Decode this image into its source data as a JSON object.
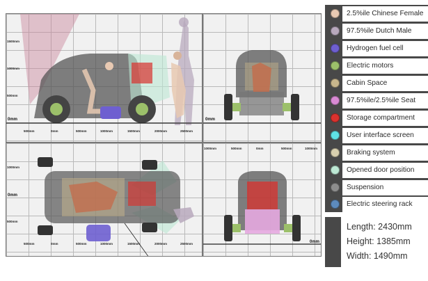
{
  "legend": {
    "items": [
      {
        "label": "2.5%ile Chinese Female",
        "color": "#e8c9b2"
      },
      {
        "label": "97.5%ile Dutch Male",
        "color": "#b8a9bd"
      },
      {
        "label": "Hydrogen fuel cell",
        "color": "#6e5fd0"
      },
      {
        "label": "Electric motors",
        "color": "#9cc06a"
      },
      {
        "label": "Cabin Space",
        "color": "#c8b68c"
      },
      {
        "label": "97.5%ile/2.5%ile Seat",
        "color": "#d98ad4"
      },
      {
        "label": "Storage compartment",
        "color": "#d9322e"
      },
      {
        "label": "User interface screen",
        "color": "#5fe3e6"
      },
      {
        "label": "Braking system",
        "color": "#d8cfae"
      },
      {
        "label": "Opened door position",
        "color": "#bde8d4"
      },
      {
        "label": "Suspension",
        "color": "#8e8e8e"
      },
      {
        "label": "Electric steering rack",
        "color": "#5d8bbd"
      }
    ]
  },
  "dimensions": {
    "length": "Length: 2430mm",
    "height": "Height: 1385mm",
    "width": "Width: 1490mm"
  },
  "side_view": {
    "y_ticks": [
      "1500mm",
      "1000mm",
      "500mm"
    ],
    "zero_left": "0mm",
    "x_ticks": [
      "500mm",
      "0mm",
      "500mm",
      "1000mm",
      "1500mm",
      "2000mm",
      "2500mm"
    ]
  },
  "front_view": {
    "zero_label": "0mm"
  },
  "top_view": {
    "y_ticks": [
      "1000mm",
      "0mm",
      "500mm"
    ],
    "x_ticks": [
      "500mm",
      "0mm",
      "500mm",
      "1000mm",
      "1500mm",
      "2000mm",
      "2500mm"
    ]
  },
  "rear_view": {
    "x_ticks": [
      "1000mm",
      "500mm",
      "0mm",
      "500mm",
      "1000mm"
    ],
    "zero_label": "0mm"
  }
}
